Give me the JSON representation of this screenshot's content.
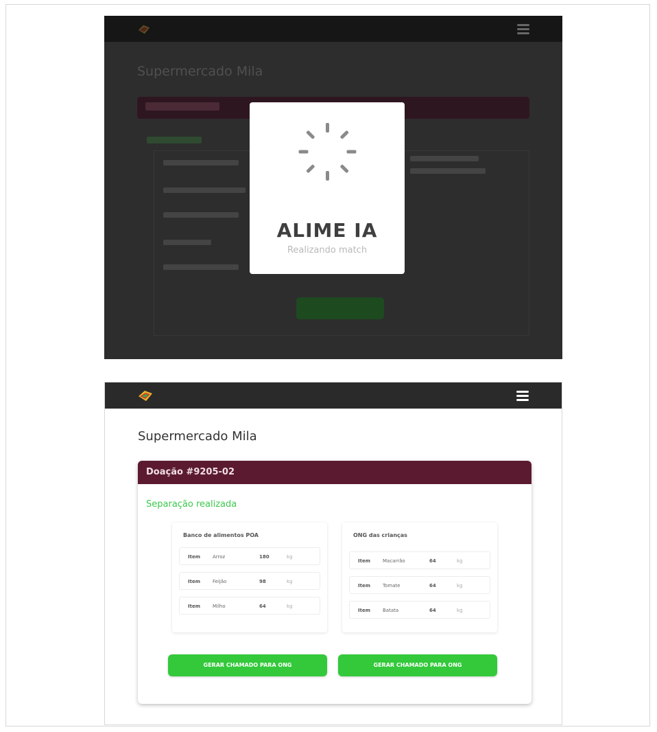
{
  "top_screen": {
    "loader": {
      "brand": "ALIME IA",
      "subtitle": "Realizando match"
    }
  },
  "bottom_screen": {
    "store_title": "Supermercado Mila",
    "donation": {
      "header": "Doação #9205-02",
      "status": "Separação realizada",
      "status_color": "#3cc94c",
      "header_color": "#5b1a30"
    },
    "panels": [
      {
        "title": "Banco de alimentos POA",
        "rows": [
          {
            "type": "Item",
            "name": "Arroz",
            "qty": "180",
            "unit": "kg"
          },
          {
            "type": "Item",
            "name": "Feijão",
            "qty": "98",
            "unit": "kg"
          },
          {
            "type": "Item",
            "name": "Milho",
            "qty": "64",
            "unit": "kg"
          }
        ],
        "button": "GERAR CHAMADO PARA ONG"
      },
      {
        "title": "ONG das crianças",
        "rows": [
          {
            "type": "Item",
            "name": "Macarrão",
            "qty": "64",
            "unit": "kg"
          },
          {
            "type": "Item",
            "name": "Tomate",
            "qty": "64",
            "unit": "kg"
          },
          {
            "type": "Item",
            "name": "Batata",
            "qty": "64",
            "unit": "kg"
          }
        ],
        "button": "GERAR CHAMADO PARA ONG"
      }
    ],
    "button_color": "#33c93b"
  }
}
